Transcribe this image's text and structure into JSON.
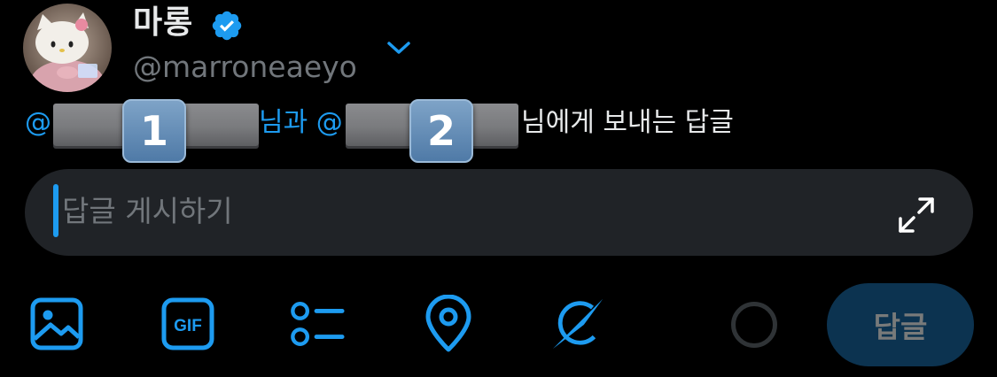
{
  "profile": {
    "display_name": "마롱",
    "handle": "@marroneaeyo",
    "verified": true,
    "avatar_icon": "hello-kitty-avatar"
  },
  "reply_context": {
    "at_prefix_1": "@",
    "joiner": "님과 @",
    "suffix": "님에게 보내는 답글",
    "badge_1": "1",
    "badge_2": "2"
  },
  "composer": {
    "placeholder": "답글 게시하기",
    "value": "",
    "expand_icon": "expand-arrows-icon"
  },
  "toolbar": {
    "items": [
      {
        "icon": "image-icon"
      },
      {
        "icon": "gif-icon",
        "label": "GIF"
      },
      {
        "icon": "poll-icon"
      },
      {
        "icon": "location-icon"
      },
      {
        "icon": "grok-icon"
      }
    ],
    "reply_label": "답글"
  },
  "colors": {
    "accent": "#1d9bf0",
    "background": "#000000",
    "input_bg": "#202327",
    "muted_text": "#71767b",
    "reply_button_bg": "#0c3350",
    "redaction": "#7a7b7e",
    "badge": "#5f8bb8"
  }
}
